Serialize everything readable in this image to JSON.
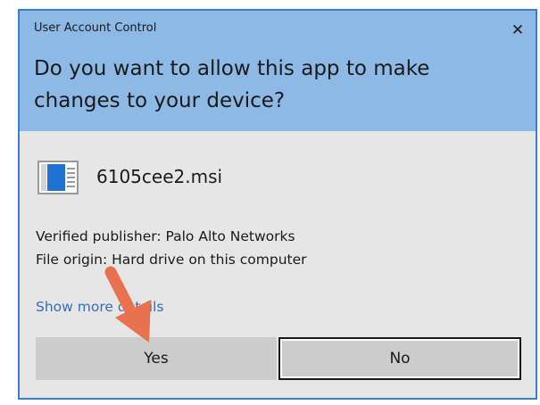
{
  "window": {
    "title": "User Account Control",
    "close_glyph": "✕"
  },
  "prompt": {
    "question": "Do you want to allow this app to make changes to your device?"
  },
  "app": {
    "icon": "installer-package-icon",
    "name": "6105cee2.msi"
  },
  "details": {
    "publisher": "Verified publisher: Palo Alto Networks",
    "origin": "File origin: Hard drive on this computer",
    "show_more": "Show more details"
  },
  "buttons": {
    "yes": "Yes",
    "no": "No"
  },
  "annotation": {
    "type": "arrow",
    "color": "#e8714f",
    "points_to": "yes-button"
  },
  "colors": {
    "header": "#8cb9e6",
    "border": "#3e7fc4",
    "body": "#e6e6e6",
    "link": "#2f6fc0",
    "button": "#cccccc"
  }
}
